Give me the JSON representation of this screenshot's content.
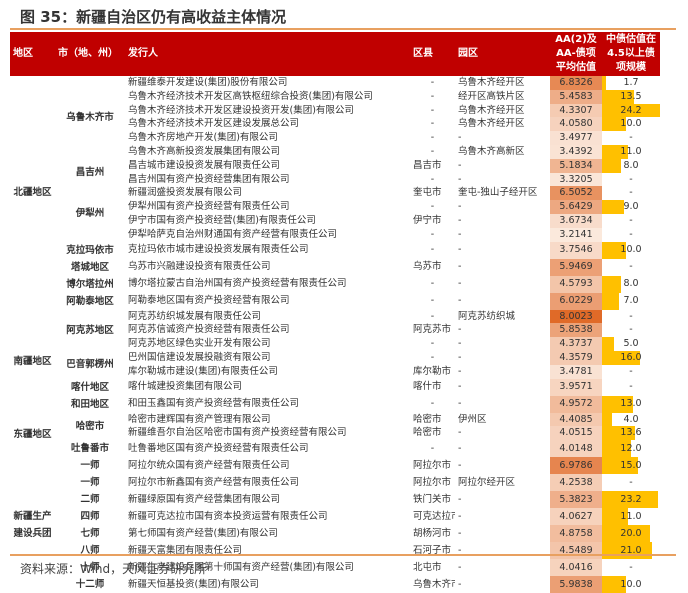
{
  "title": "图 35：新疆自治区仍有高收益主体情况",
  "source": "资料来源：Wind，天风证券研究所",
  "colors": {
    "header": "#c00000",
    "bar": "#ffc000",
    "heat_low": "#fbe9dd",
    "heat_high": "#e06a28"
  },
  "headers": {
    "region": "地区",
    "city": "市（地、州）",
    "issuer": "发行人",
    "county": "区县",
    "park": "园区",
    "avg": "AA(2)及AA-债项平均估值",
    "scale": "中债估值在4.5以上债项规模"
  },
  "scale_max": 24.2,
  "rows": [
    {
      "region": "北疆地区",
      "rs": 16,
      "city": "乌鲁木齐市",
      "cs": 6,
      "issuer": "新疆维泰开发建设(集团)股份有限公司",
      "county": "-",
      "park": "乌鲁木齐经开区",
      "avg": "6.8326",
      "scale": "1.7"
    },
    {
      "issuer": "乌鲁木齐经济技术开发区高铁枢纽综合投资(集团)有限公司",
      "county": "-",
      "park": "经开区高铁片区",
      "avg": "5.4583",
      "scale": "13.5"
    },
    {
      "issuer": "乌鲁木齐经济技术开发区建设投资开发(集团)有限公司",
      "county": "-",
      "park": "乌鲁木齐经开区",
      "avg": "4.3307",
      "scale": "24.2"
    },
    {
      "issuer": "乌鲁木齐经济技术开发区建设发展总公司",
      "county": "-",
      "park": "乌鲁木齐经开区",
      "avg": "4.0580",
      "scale": "10.0"
    },
    {
      "issuer": "乌鲁木齐房地产开发(集团)有限公司",
      "county": "-",
      "park": "-",
      "avg": "3.4977",
      "scale": "-"
    },
    {
      "issuer": "乌鲁木齐高新投资发展集团有限公司",
      "county": "-",
      "park": "乌鲁木齐高新区",
      "avg": "3.4392",
      "scale": "11.0"
    },
    {
      "city": "昌吉州",
      "cs": 2,
      "issuer": "昌吉城市建设投资发展有限责任公司",
      "county": "昌吉市",
      "park": "-",
      "avg": "5.1834",
      "scale": "8.0"
    },
    {
      "issuer": "昌吉州国有资产投资经营集团有限公司",
      "county": "-",
      "park": "-",
      "avg": "3.3205",
      "scale": "-"
    },
    {
      "city": "伊犁州",
      "cs": 4,
      "issuer": "新疆润盛投资发展有限公司",
      "county": "奎屯市",
      "park": "奎屯-独山子经开区",
      "avg": "6.5052",
      "scale": "-"
    },
    {
      "issuer": "伊犁州国有资产投资经营有限责任公司",
      "county": "-",
      "park": "-",
      "avg": "5.6429",
      "scale": "9.0"
    },
    {
      "issuer": "伊宁市国有资产投资经营(集团)有限责任公司",
      "county": "伊宁市",
      "park": "-",
      "avg": "3.6734",
      "scale": "-"
    },
    {
      "issuer": "伊犁哈萨克自治州财通国有资产经营有限责任公司",
      "county": "-",
      "park": "-",
      "avg": "3.2141",
      "scale": "-"
    },
    {
      "city": "克拉玛依市",
      "cs": 1,
      "issuer": "克拉玛依市城市建设投资发展有限责任公司",
      "county": "-",
      "park": "-",
      "avg": "3.7546",
      "scale": "10.0"
    },
    {
      "city": "塔城地区",
      "cs": 1,
      "issuer": "乌苏市兴融建设投资有限责任公司",
      "county": "乌苏市",
      "park": "-",
      "avg": "5.9469",
      "scale": "-"
    },
    {
      "city": "博尔塔拉州",
      "cs": 1,
      "issuer": "博尔塔拉蒙古自治州国有资产投资经营有限责任公司",
      "county": "-",
      "park": "-",
      "avg": "4.5793",
      "scale": "8.0"
    },
    {
      "city": "阿勒泰地区",
      "cs": 1,
      "issuer": "阿勒泰地区国有资产投资经营有限公司",
      "county": "-",
      "park": "-",
      "avg": "6.0229",
      "scale": "7.0"
    },
    {
      "region": "南疆地区",
      "rs": 7,
      "city": "阿克苏地区",
      "cs": 3,
      "issuer": "阿克苏纺织城发展有限责任公司",
      "county": "-",
      "park": "阿克苏纺织城",
      "avg": "8.0023",
      "scale": "-"
    },
    {
      "issuer": "阿克苏信诚资产投资经营有限责任公司",
      "county": "阿克苏市",
      "park": "-",
      "avg": "5.8538",
      "scale": "-"
    },
    {
      "issuer": "阿克苏地区绿色实业开发有限公司",
      "county": "-",
      "park": "-",
      "avg": "4.3737",
      "scale": "5.0"
    },
    {
      "city": "巴音郭楞州",
      "cs": 2,
      "issuer": "巴州国信建设发展投融资有限公司",
      "county": "-",
      "park": "-",
      "avg": "4.3579",
      "scale": "16.0"
    },
    {
      "issuer": "库尔勒城市建设(集团)有限责任公司",
      "county": "库尔勒市",
      "park": "-",
      "avg": "3.4781",
      "scale": "-"
    },
    {
      "city": "喀什地区",
      "cs": 1,
      "issuer": "喀什城建投资集团有限公司",
      "county": "喀什市",
      "park": "-",
      "avg": "3.9571",
      "scale": "-"
    },
    {
      "city": "和田地区",
      "cs": 1,
      "issuer": "和田玉鑫国有资产投资经营有限责任公司",
      "county": "-",
      "park": "-",
      "avg": "4.9572",
      "scale": "13.0"
    },
    {
      "region": "东疆地区",
      "rs": 3,
      "city": "哈密市",
      "cs": 2,
      "issuer": "哈密市建辉国有资产管理有限公司",
      "county": "哈密市",
      "park": "伊州区",
      "avg": "4.4085",
      "scale": "4.0"
    },
    {
      "issuer": "新疆维吾尔自治区哈密市国有资产投资经营有限公司",
      "county": "哈密市",
      "park": "-",
      "avg": "4.0515",
      "scale": "13.6"
    },
    {
      "city": "吐鲁番市",
      "cs": 1,
      "issuer": "吐鲁番地区国有资产投资经营有限责任公司",
      "county": "-",
      "park": "-",
      "avg": "4.0148",
      "scale": "12.0"
    },
    {
      "region": "新疆生产建设兵团",
      "rs": 8,
      "city": "一师",
      "cs": 1,
      "issuer": "阿拉尔统众国有资产经营有限责任公司",
      "county": "阿拉尔市",
      "park": "-",
      "avg": "6.9786",
      "scale": "15.0"
    },
    {
      "city": "一师",
      "cs": 1,
      "issuer": "阿拉尔市新鑫国有资产经营有限责任公司",
      "county": "阿拉尔市",
      "park": "阿拉尔经开区",
      "avg": "4.2538",
      "scale": "-"
    },
    {
      "city": "二师",
      "cs": 1,
      "issuer": "新疆绿原国有资产经营集团有限公司",
      "county": "铁门关市",
      "park": "-",
      "avg": "5.3823",
      "scale": "23.2"
    },
    {
      "city": "四师",
      "cs": 1,
      "issuer": "新疆可克达拉市国有资本投资运营有限责任公司",
      "county": "可克达拉市",
      "park": "-",
      "avg": "4.0627",
      "scale": "11.0"
    },
    {
      "city": "七师",
      "cs": 1,
      "issuer": "第七师国有资产经营(集团)有限公司",
      "county": "胡杨河市",
      "park": "-",
      "avg": "4.8758",
      "scale": "20.0"
    },
    {
      "city": "八师",
      "cs": 1,
      "issuer": "新疆天富集团有限责任公司",
      "county": "石河子市",
      "park": "-",
      "avg": "4.5489",
      "scale": "21.0"
    },
    {
      "city": "十师",
      "cs": 1,
      "issuer": "新疆生产建设兵团第十师国有资产经营(集团)有限公司",
      "county": "北屯市",
      "park": "-",
      "avg": "4.0416",
      "scale": "-"
    },
    {
      "city": "十二师",
      "cs": 1,
      "issuer": "新疆天恒基投资(集团)有限公司",
      "county": "乌鲁木齐市",
      "park": "-",
      "avg": "5.9838",
      "scale": "10.0"
    }
  ]
}
